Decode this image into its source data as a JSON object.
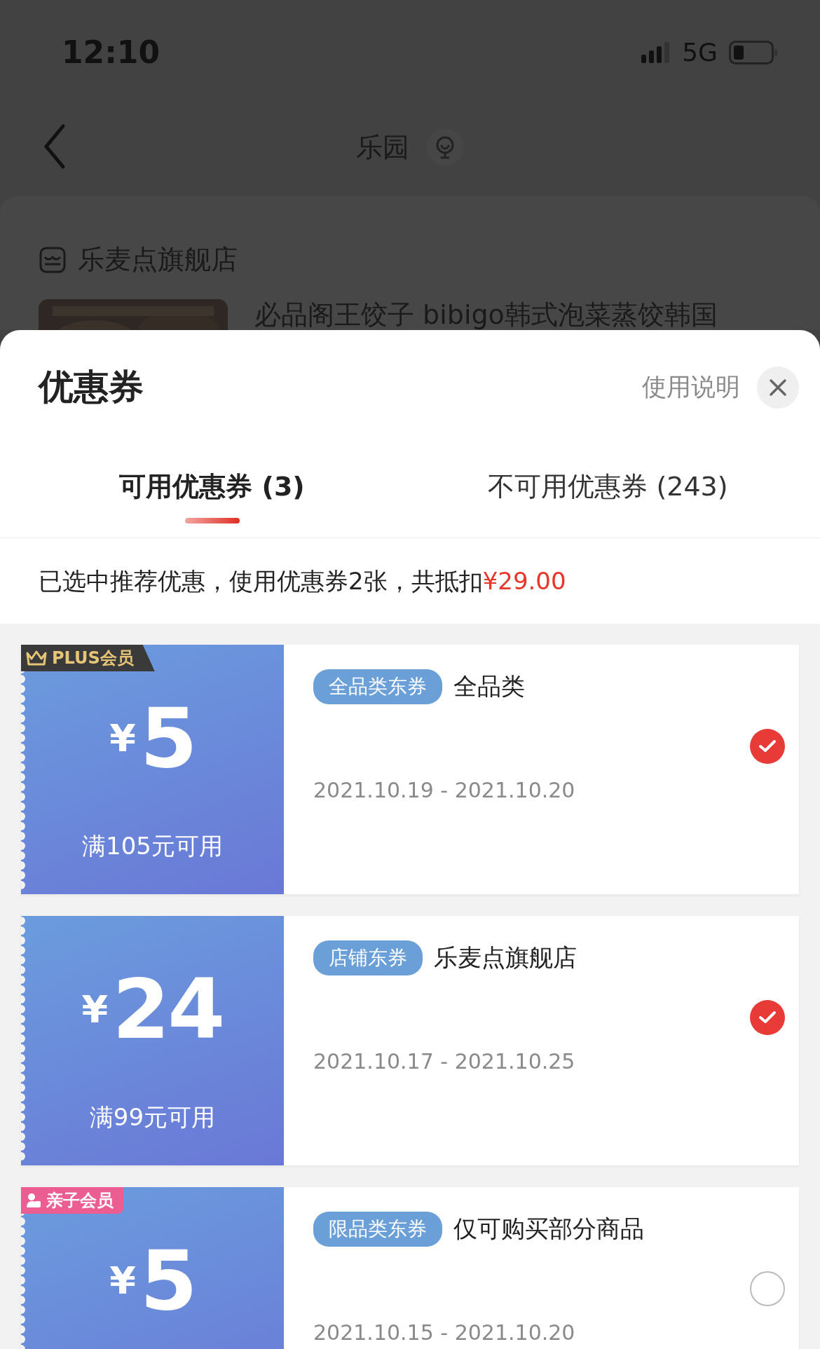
{
  "status_bar": {
    "time": "12:10",
    "network": "5G"
  },
  "nav": {
    "title": "乐园"
  },
  "background": {
    "store": "乐麦点旗舰店",
    "product_title": "必品阁王饺子 bibigo韩式泡菜蒸饺韩国"
  },
  "sheet": {
    "title": "优惠券",
    "help_link": "使用说明"
  },
  "tabs": [
    {
      "label": "可用优惠券 (3)",
      "selected": true
    },
    {
      "label": "不可用优惠券 (243)",
      "selected": false
    }
  ],
  "summary": {
    "text": "已选中推荐优惠，使用优惠券2张，共抵扣",
    "amount": "¥29.00"
  },
  "coupons": [
    {
      "badge": {
        "kind": "plus",
        "label": "PLUS会员"
      },
      "currency": "¥",
      "amount": "5",
      "condition": "满105元可用",
      "tag": "全品类东券",
      "scope": "全品类",
      "dates": "2021.10.19 - 2021.10.20",
      "checked": true
    },
    {
      "currency": "¥",
      "amount": "24",
      "condition": "满99元可用",
      "tag": "店铺东券",
      "scope": "乐麦点旗舰店",
      "dates": "2021.10.17 - 2021.10.25",
      "checked": true
    },
    {
      "badge": {
        "kind": "family",
        "label": "亲子会员"
      },
      "currency": "¥",
      "amount": "5",
      "tag": "限品类东券",
      "scope": "仅可购买部分商品",
      "dates": "2021.10.15 - 2021.10.20",
      "checked": false
    }
  ]
}
